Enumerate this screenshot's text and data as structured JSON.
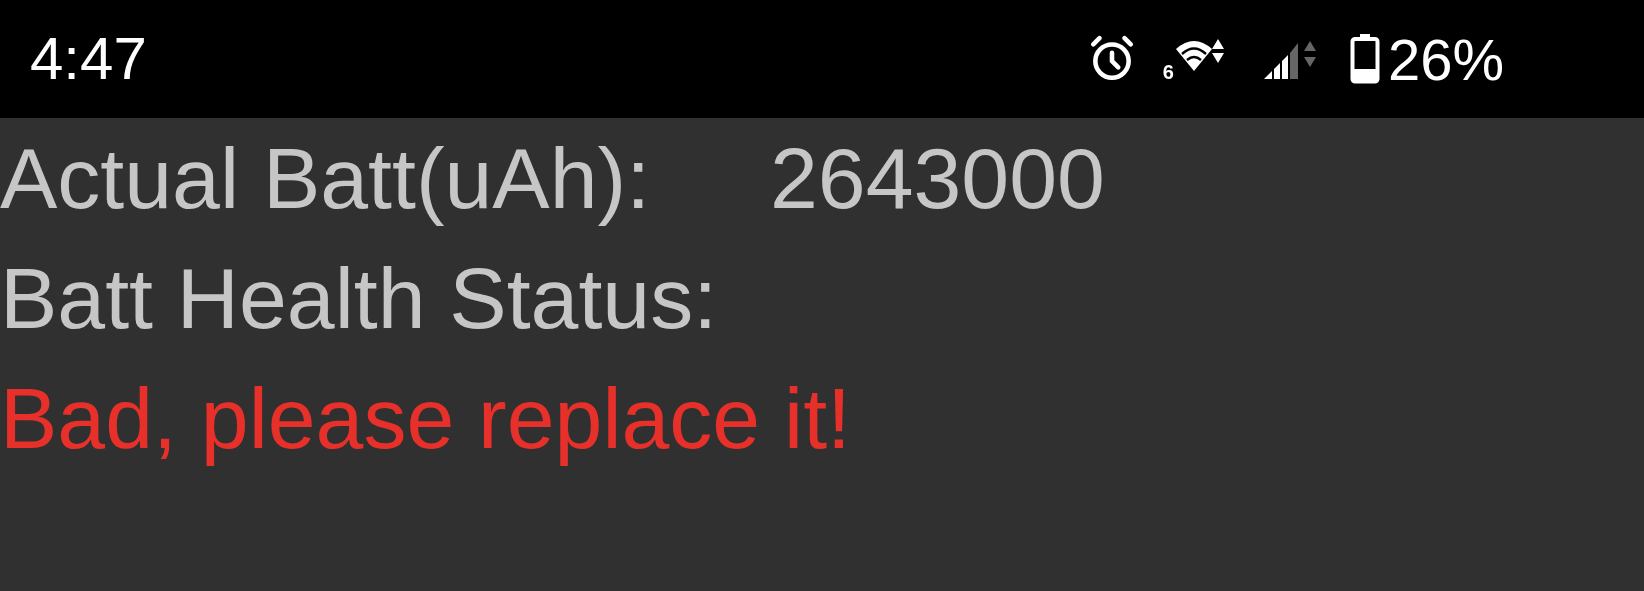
{
  "status_bar": {
    "time": "4:47",
    "wifi_badge": "6",
    "battery": "26%"
  },
  "rows": [
    {
      "label": "Actual Batt(uAh):",
      "value": "2643000"
    },
    {
      "label": "Batt Health Status:"
    }
  ],
  "health_message": {
    "text": "Bad, please replace it!",
    "kind": "warning"
  }
}
